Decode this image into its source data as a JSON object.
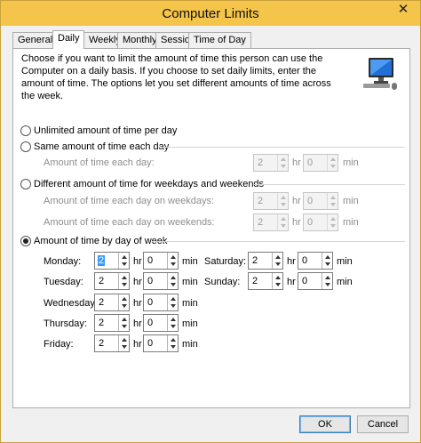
{
  "window": {
    "title": "Computer Limits",
    "close_glyph": "✕"
  },
  "tabs": [
    "General",
    "Daily",
    "Weekly",
    "Monthly",
    "Session",
    "Time of Day"
  ],
  "active_tab": "Daily",
  "description": "Choose if you want to limit the amount of time this person can use the Computer on a daily basis. If you choose to set daily limits, enter the amount of time. The options let you set different amounts of time across the week.",
  "options": {
    "unlimited": {
      "label": "Unlimited amount of time per day",
      "checked": false
    },
    "same": {
      "label": "Same amount of time each day",
      "checked": false,
      "row_label": "Amount of time each day:",
      "hr": "2",
      "min": "0"
    },
    "weekdays_weekends": {
      "label": "Different amount of time for weekdays and weekends",
      "checked": false,
      "weekdays_label": "Amount of time each day on weekdays:",
      "weekdays_hr": "2",
      "weekdays_min": "0",
      "weekends_label": "Amount of time each day on weekends:",
      "weekends_hr": "2",
      "weekends_min": "0"
    },
    "by_day": {
      "label": "Amount of time by day of week",
      "checked": true,
      "days": [
        {
          "label": "Monday:",
          "hr": "2",
          "min": "0"
        },
        {
          "label": "Tuesday:",
          "hr": "2",
          "min": "0"
        },
        {
          "label": "Wednesday:",
          "hr": "2",
          "min": "0"
        },
        {
          "label": "Thursday:",
          "hr": "2",
          "min": "0"
        },
        {
          "label": "Friday:",
          "hr": "2",
          "min": "0"
        },
        {
          "label": "Saturday:",
          "hr": "2",
          "min": "0"
        },
        {
          "label": "Sunday:",
          "hr": "2",
          "min": "0"
        }
      ]
    }
  },
  "units": {
    "hr": "hr",
    "min": "min"
  },
  "buttons": {
    "ok": "OK",
    "cancel": "Cancel"
  },
  "icons": {
    "close": "close-icon",
    "monitor": "computer-monitor-icon"
  }
}
